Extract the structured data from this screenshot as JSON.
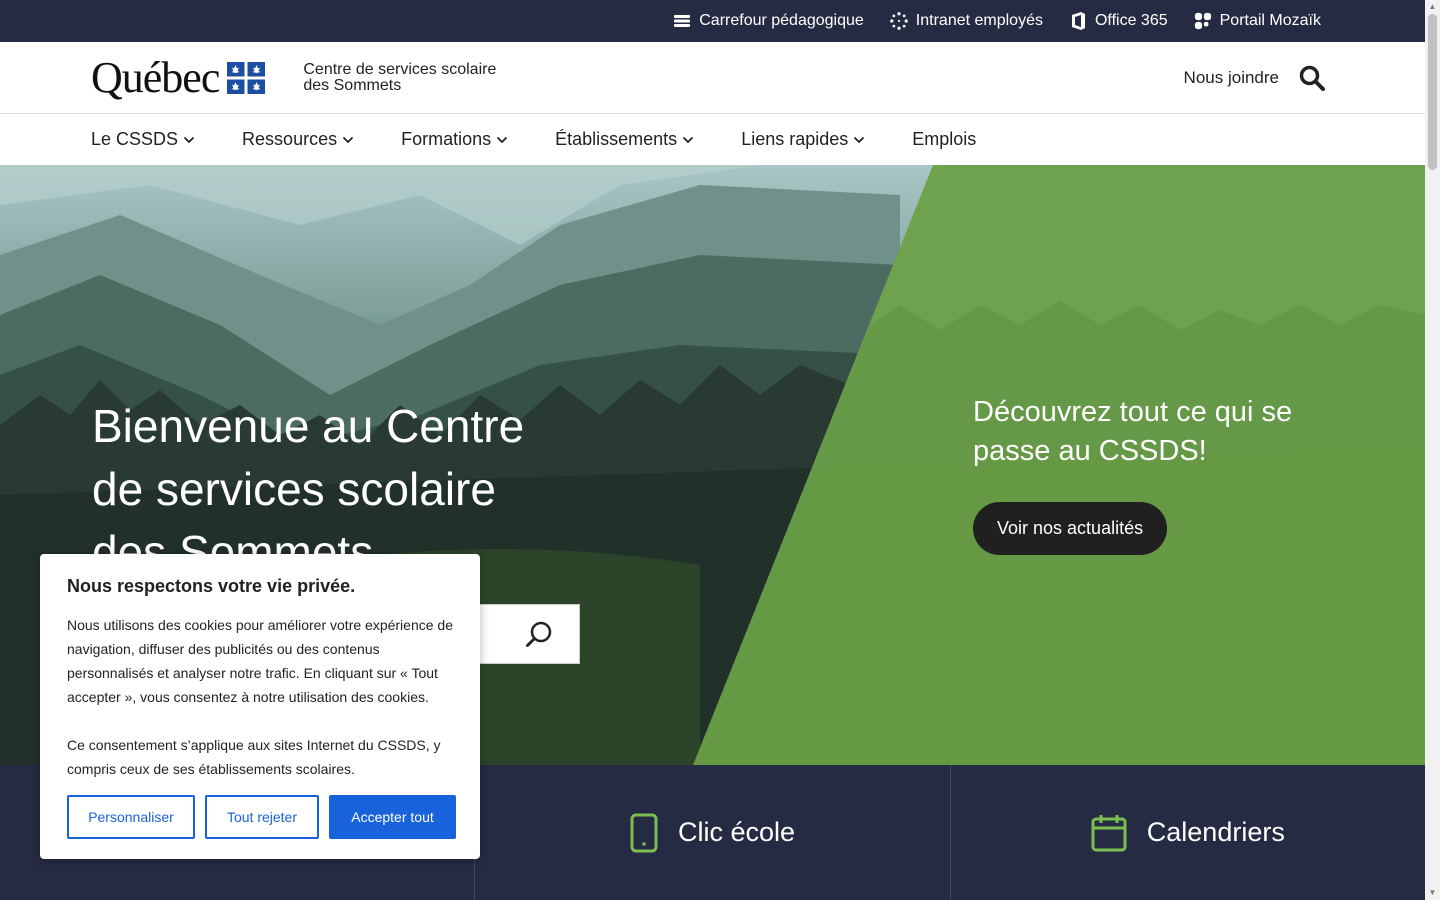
{
  "topbar": {
    "links": [
      {
        "label": "Carrefour pédagogique",
        "icon": "book-icon"
      },
      {
        "label": "Intranet employés",
        "icon": "network-icon"
      },
      {
        "label": "Office 365",
        "icon": "office-icon"
      },
      {
        "label": "Portail Mozaïk",
        "icon": "puzzle-icon"
      }
    ]
  },
  "header": {
    "logo_text": "Québec",
    "org_name": "Centre de services scolaire des Sommets",
    "contact_label": "Nous joindre"
  },
  "nav": {
    "items": [
      {
        "label": "Le CSSDS"
      },
      {
        "label": "Ressources"
      },
      {
        "label": "Formations"
      },
      {
        "label": "Établissements"
      },
      {
        "label": "Liens rapides"
      },
      {
        "label": "Emplois"
      }
    ]
  },
  "hero": {
    "title": "Bienvenue au Centre de services scolaire des Sommets",
    "promo_text": "Découvrez tout ce qui se passe au CSSDS!",
    "promo_button": "Voir nos actualités"
  },
  "quick_links": [
    {
      "label": "",
      "icon": "calendar-icon"
    },
    {
      "label": "Clic école",
      "icon": "tablet-icon"
    },
    {
      "label": "Calendriers",
      "icon": "calendar-icon"
    }
  ],
  "cookie": {
    "title": "Nous respectons votre vie privée.",
    "paragraph1": "Nous utilisons des cookies pour améliorer votre expérience de navigation, diffuser des publicités ou des contenus personnalisés et analyser notre trafic. En cliquant sur « Tout accepter », vous consentez à notre utilisation des cookies.",
    "paragraph2": "Ce consentement s’applique aux sites Internet du CSSDS, y compris ceux de ses établissements scolaires.",
    "customize": "Personnaliser",
    "reject": "Tout rejeter",
    "accept": "Accepter tout"
  },
  "colors": {
    "topbar": "#262b44",
    "green": "#6ea24f",
    "accent_blue": "#1863dc",
    "icon_green": "#7cbd4f"
  }
}
